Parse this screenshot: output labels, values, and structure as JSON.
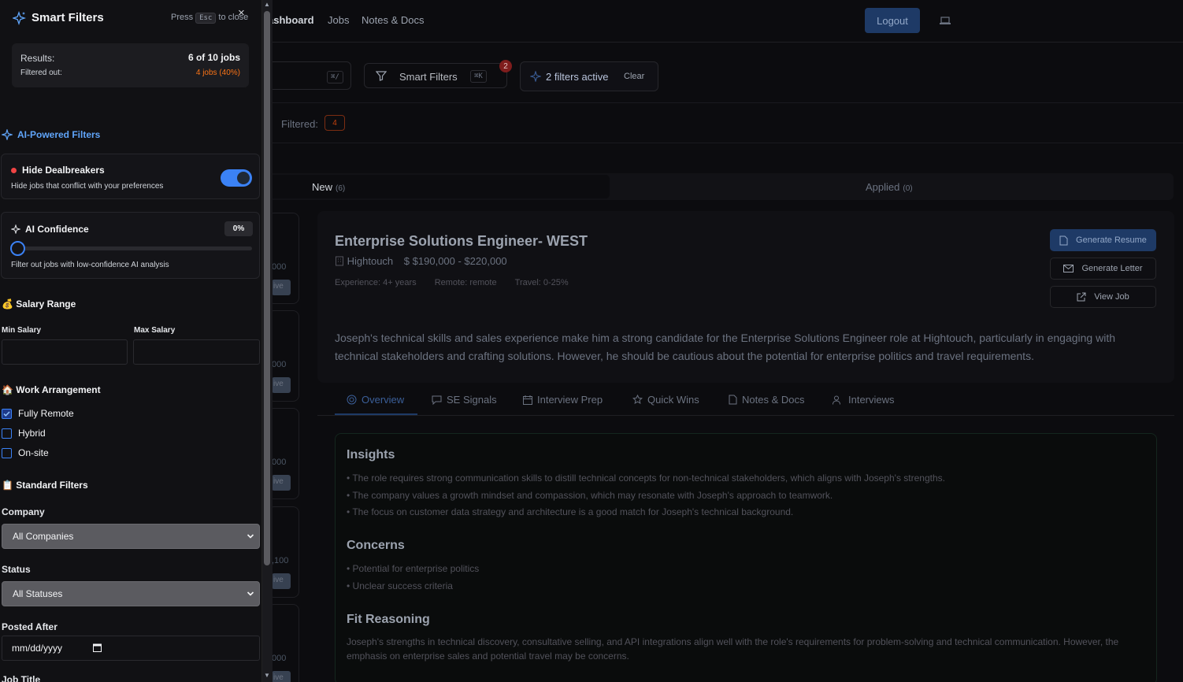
{
  "nav": {
    "items": [
      "ashboard",
      "Jobs",
      "Notes & Docs"
    ],
    "logout_label": "Logout"
  },
  "toolbar": {
    "search_shortcut": "⌘/",
    "smart_filters_label": "Smart Filters",
    "smart_filters_shortcut": "⌘K",
    "smart_filters_count": "2",
    "filters_active_label": "2 filters active",
    "clear_label": "Clear"
  },
  "filter_bar": {
    "filtered_label": "Filtered:",
    "filtered_count": "4"
  },
  "status_tabs": [
    {
      "label": "New",
      "count": "(6)"
    },
    {
      "label": "Applied",
      "count": "(0)"
    }
  ],
  "job_cards": [
    {
      "salary_fragment": "000",
      "chip": "ive"
    },
    {
      "salary_fragment": "000",
      "chip": "ive"
    },
    {
      "salary_fragment": "000",
      "chip": "ive"
    },
    {
      "salary_fragment": ",100",
      "chip": "ive"
    },
    {
      "salary_fragment": "000",
      "chip": "ive"
    }
  ],
  "job": {
    "title": "Enterprise Solutions Engineer- WEST",
    "company": "Hightouch",
    "salary": "$190,000 - $220,000",
    "experience": "Experience: 4+ years",
    "remote": "Remote: remote",
    "travel": "Travel: 0-25%",
    "summary": "Joseph's technical skills and sales experience make him a strong candidate for the Enterprise Solutions Engineer role at Hightouch, particularly in engaging with technical stakeholders and crafting solutions. However, he should be cautious about the potential for enterprise politics and travel requirements.",
    "actions": [
      "Generate Resume",
      "Generate Letter",
      "View Job"
    ]
  },
  "detail_tabs": [
    "Overview",
    "SE Signals",
    "Interview Prep",
    "Quick Wins",
    "Notes & Docs",
    "Interviews"
  ],
  "insights": {
    "insights_title": "Insights",
    "insights_items": [
      "• The role requires strong communication skills to distill technical concepts for non-technical stakeholders, which aligns with Joseph's strengths.",
      "• The company values a growth mindset and compassion, which may resonate with Joseph's approach to teamwork.",
      "• The focus on customer data strategy and architecture is a good match for Joseph's technical background."
    ],
    "concerns_title": "Concerns",
    "concerns_items": [
      "• Potential for enterprise politics",
      "• Unclear success criteria"
    ],
    "fit_title": "Fit Reasoning",
    "fit_text": "Joseph's strengths in technical discovery, consultative selling, and API integrations align well with the role's requirements for problem-solving and technical communication. However, the emphasis on enterprise sales and potential travel may be concerns."
  },
  "panel": {
    "title": "Smart Filters",
    "esc_prefix": "Press",
    "esc_key": "Esc",
    "esc_suffix": "to close",
    "close_glyph": "×",
    "results_label": "Results:",
    "results_value": "6 of 10 jobs",
    "filtered_out_label": "Filtered out:",
    "filtered_out_value": "4 jobs (40%)",
    "ai_section_title": "AI-Powered Filters",
    "dealbreakers": {
      "title": "Hide Dealbreakers",
      "desc": "Hide jobs that conflict with your preferences",
      "enabled": true
    },
    "confidence": {
      "title": "AI Confidence",
      "value_label": "0%",
      "value": 0,
      "desc": "Filter out jobs with low-confidence AI analysis"
    },
    "salary_section_title": "💰 Salary Range",
    "min_salary_label": "Min Salary",
    "max_salary_label": "Max Salary",
    "work_section_title": "🏠 Work Arrangement",
    "work_options": [
      {
        "label": "Fully Remote",
        "checked": true
      },
      {
        "label": "Hybrid",
        "checked": false
      },
      {
        "label": "On-site",
        "checked": false
      }
    ],
    "standard_section_title": "📋 Standard Filters",
    "company_label": "Company",
    "company_value": "All Companies",
    "status_label": "Status",
    "status_value": "All Statuses",
    "posted_after_label": "Posted After",
    "posted_after_placeholder": "mm/dd/yyyy",
    "job_title_label": "Job Title"
  },
  "colors": {
    "accent": "#3b82f6",
    "danger": "#ef4444",
    "warning": "#f97316"
  }
}
